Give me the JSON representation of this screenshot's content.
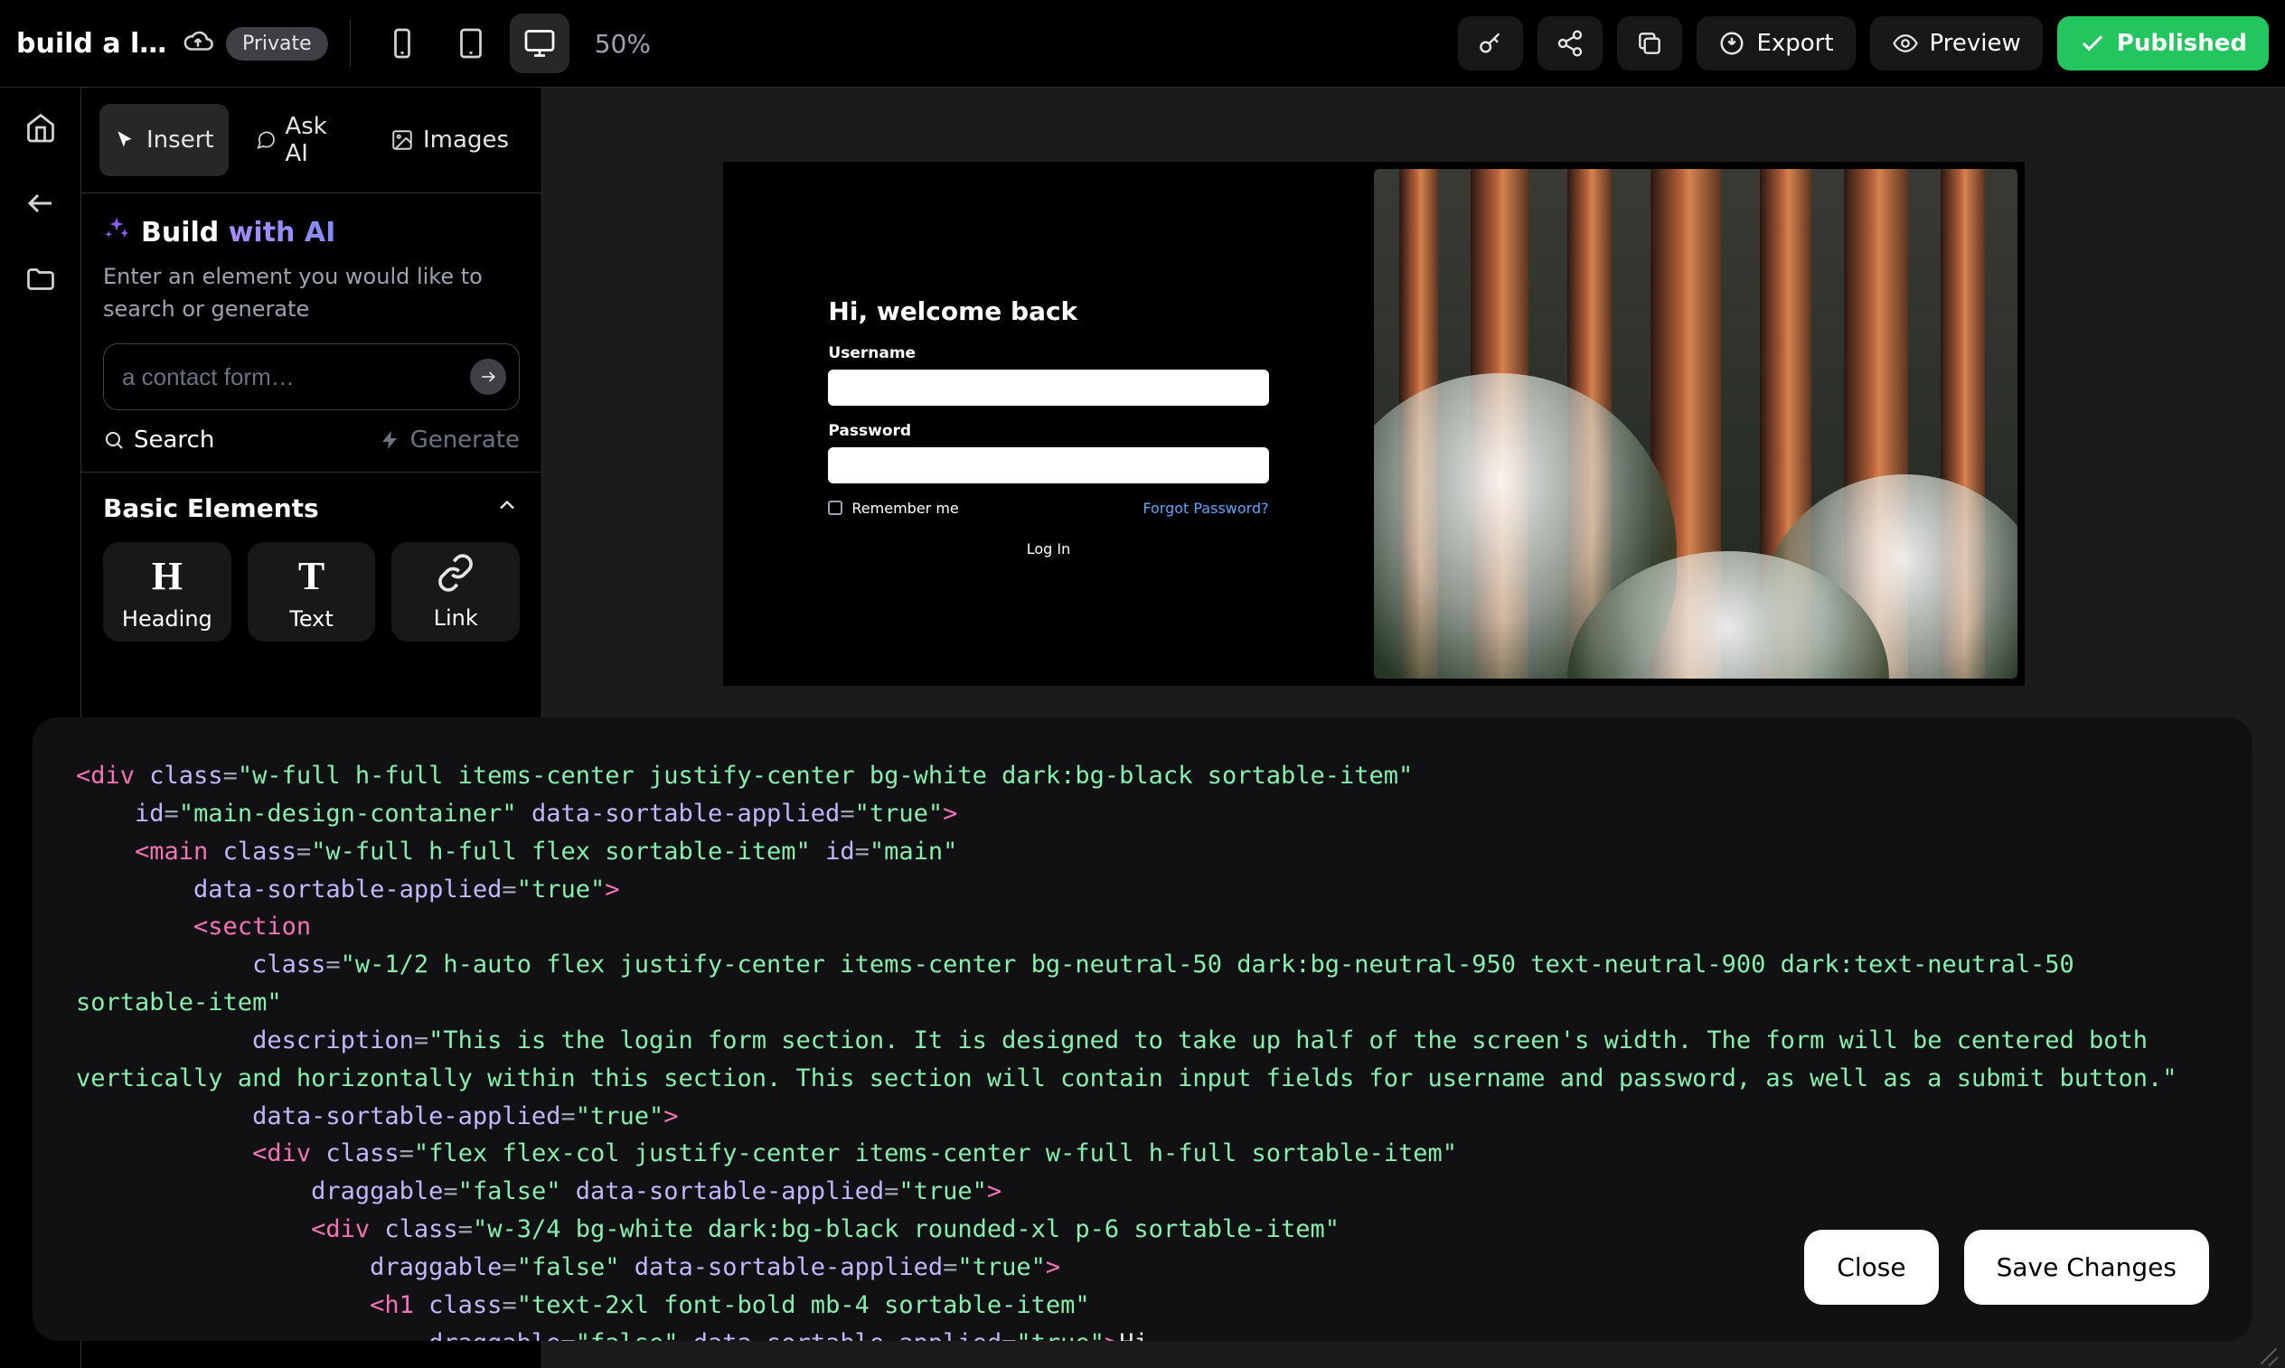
{
  "topbar": {
    "title": "build a logi…",
    "privacy": "Private",
    "zoom": "50%",
    "export": "Export",
    "preview": "Preview",
    "published": "Published"
  },
  "sidebar": {
    "tabs": {
      "insert": "Insert",
      "ask_ai": "Ask AI",
      "images": "Images"
    },
    "ai": {
      "title_prefix": "Build ",
      "title_accent": "with AI",
      "description": "Enter an element you would like to search or generate",
      "placeholder": "a contact form…",
      "search": "Search",
      "generate": "Generate"
    },
    "basic": {
      "heading": "Basic Elements",
      "items": [
        {
          "glyph": "H",
          "label": "Heading"
        },
        {
          "glyph": "T",
          "label": "Text"
        },
        {
          "glyph": "link",
          "label": "Link"
        }
      ]
    }
  },
  "login": {
    "title": "Hi, welcome back",
    "username": "Username",
    "password": "Password",
    "remember": "Remember me",
    "forgot": "Forgot Password?",
    "submit": "Log In"
  },
  "code_panel": {
    "close": "Close",
    "save": "Save Changes",
    "lines": [
      [
        [
          "t",
          "<div"
        ],
        [
          "a",
          " class"
        ],
        [
          "p",
          "="
        ],
        [
          "s",
          "\"w-full h-full items-center justify-center bg-white dark:bg-black sortable-item\""
        ]
      ],
      [
        [
          "p",
          "    "
        ],
        [
          "a",
          "id"
        ],
        [
          "p",
          "="
        ],
        [
          "s",
          "\"main-design-container\""
        ],
        [
          "a",
          " data-sortable-applied"
        ],
        [
          "p",
          "="
        ],
        [
          "s",
          "\"true\""
        ],
        [
          "t",
          ">"
        ]
      ],
      [
        [
          "p",
          "    "
        ],
        [
          "t",
          "<main"
        ],
        [
          "a",
          " class"
        ],
        [
          "p",
          "="
        ],
        [
          "s",
          "\"w-full h-full flex sortable-item\""
        ],
        [
          "a",
          " id"
        ],
        [
          "p",
          "="
        ],
        [
          "s",
          "\"main\""
        ]
      ],
      [
        [
          "p",
          "        "
        ],
        [
          "a",
          "data-sortable-applied"
        ],
        [
          "p",
          "="
        ],
        [
          "s",
          "\"true\""
        ],
        [
          "t",
          ">"
        ]
      ],
      [
        [
          "p",
          "        "
        ],
        [
          "t",
          "<section"
        ]
      ],
      [
        [
          "p",
          "            "
        ],
        [
          "a",
          "class"
        ],
        [
          "p",
          "="
        ],
        [
          "s",
          "\"w-1/2 h-auto flex justify-center items-center bg-neutral-50 dark:bg-neutral-950 text-neutral-900 dark:text-neutral-50 sortable-item\""
        ]
      ],
      [
        [
          "p",
          "            "
        ],
        [
          "a",
          "description"
        ],
        [
          "p",
          "="
        ],
        [
          "s",
          "\"This is the login form section. It is designed to take up half of the screen's width. The form will be centered both vertically and horizontally within this section. This section will contain input fields for username and password, as well as a submit button.\""
        ]
      ],
      [
        [
          "p",
          "            "
        ],
        [
          "a",
          "data-sortable-applied"
        ],
        [
          "p",
          "="
        ],
        [
          "s",
          "\"true\""
        ],
        [
          "t",
          ">"
        ]
      ],
      [
        [
          "p",
          "            "
        ],
        [
          "t",
          "<div"
        ],
        [
          "a",
          " class"
        ],
        [
          "p",
          "="
        ],
        [
          "s",
          "\"flex flex-col justify-center items-center w-full h-full sortable-item\""
        ]
      ],
      [
        [
          "p",
          "                "
        ],
        [
          "a",
          "draggable"
        ],
        [
          "p",
          "="
        ],
        [
          "s",
          "\"false\""
        ],
        [
          "a",
          " data-sortable-applied"
        ],
        [
          "p",
          "="
        ],
        [
          "s",
          "\"true\""
        ],
        [
          "t",
          ">"
        ]
      ],
      [
        [
          "p",
          "                "
        ],
        [
          "t",
          "<div"
        ],
        [
          "a",
          " class"
        ],
        [
          "p",
          "="
        ],
        [
          "s",
          "\"w-3/4 bg-white dark:bg-black rounded-xl p-6 sortable-item\""
        ]
      ],
      [
        [
          "p",
          "                    "
        ],
        [
          "a",
          "draggable"
        ],
        [
          "p",
          "="
        ],
        [
          "s",
          "\"false\""
        ],
        [
          "a",
          " data-sortable-applied"
        ],
        [
          "p",
          "="
        ],
        [
          "s",
          "\"true\""
        ],
        [
          "t",
          ">"
        ]
      ],
      [
        [
          "p",
          "                    "
        ],
        [
          "t",
          "<h1"
        ],
        [
          "a",
          " class"
        ],
        [
          "p",
          "="
        ],
        [
          "s",
          "\"text-2xl font-bold mb-4 sortable-item\""
        ]
      ],
      [
        [
          "p",
          "                        "
        ],
        [
          "a",
          "draggable"
        ],
        [
          "p",
          "="
        ],
        [
          "s",
          "\"false\""
        ],
        [
          "a",
          " data-sortable-applied"
        ],
        [
          "p",
          "="
        ],
        [
          "s",
          "\"true\""
        ],
        [
          "t",
          ">"
        ],
        [
          "tx",
          "Hi,"
        ]
      ]
    ]
  }
}
